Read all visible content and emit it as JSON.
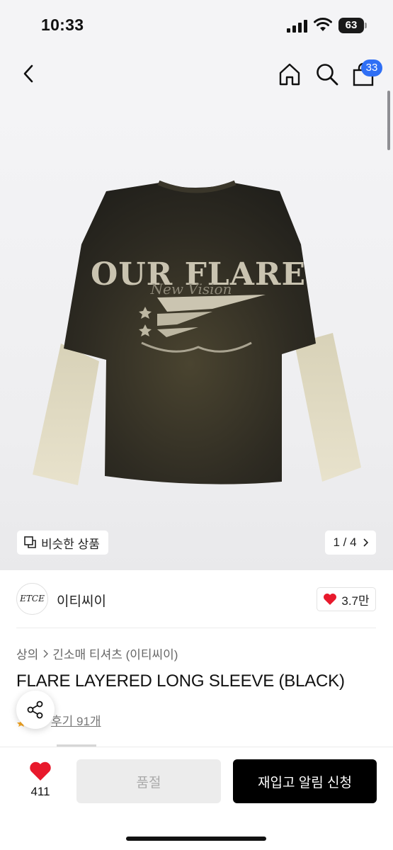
{
  "status": {
    "time": "10:33",
    "battery_level": "63"
  },
  "nav": {
    "back_icon": "chevron-left-icon",
    "home_icon": "home-icon",
    "search_icon": "search-icon",
    "cart_icon": "shopping-bag-icon",
    "cart_count": "33",
    "badge_color": "#2f6ff5"
  },
  "gallery": {
    "shirt_print_line1": "OUR FLARE",
    "shirt_print_line2": "New Vision",
    "similar_label": "비슷한 상품",
    "page_counter": "1 / 4"
  },
  "brand": {
    "logo_text": "ETCE",
    "name": "이티씨이",
    "likes": "3.7만"
  },
  "product": {
    "breadcrumb": [
      "상의",
      "긴소매 티셔츠 (이티씨이)"
    ],
    "title": "FLARE LAYERED LONG SLEEVE (BLACK)",
    "reviews": "후기 91개"
  },
  "bottom": {
    "wish_count": "411",
    "soldout_label": "품절",
    "restock_label": "재입고 알림 신청",
    "heart_color": "#e8192c"
  }
}
